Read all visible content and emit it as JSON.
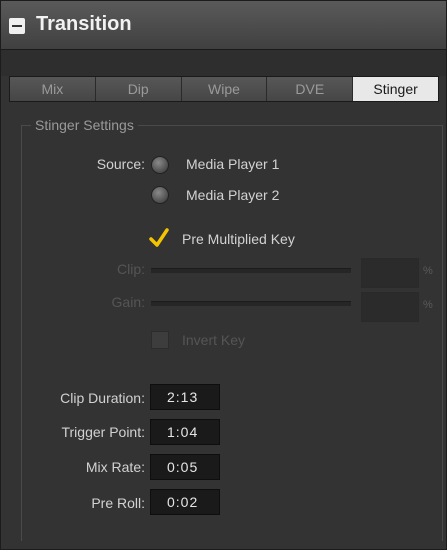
{
  "panel": {
    "title": "Transition"
  },
  "tabs": [
    {
      "label": "Mix",
      "active": false
    },
    {
      "label": "Dip",
      "active": false
    },
    {
      "label": "Wipe",
      "active": false
    },
    {
      "label": "DVE",
      "active": false
    },
    {
      "label": "Stinger",
      "active": true
    }
  ],
  "stinger": {
    "group_label": "Stinger Settings",
    "source_label": "Source:",
    "source_options": [
      "Media Player 1",
      "Media Player 2"
    ],
    "pre_multiplied_key": {
      "label": "Pre Multiplied Key",
      "checked": true
    },
    "clip": {
      "label": "Clip:",
      "unit": "%"
    },
    "gain": {
      "label": "Gain:",
      "unit": "%"
    },
    "invert_key": {
      "label": "Invert Key",
      "checked": false
    },
    "durations": [
      {
        "label": "Clip Duration:",
        "value": "2:13"
      },
      {
        "label": "Trigger Point:",
        "value": "1:04"
      },
      {
        "label": "Mix Rate:",
        "value": "0:05"
      },
      {
        "label": "Pre Roll:",
        "value": "0:02"
      }
    ]
  },
  "colors": {
    "check_accent": "#f5c400",
    "active_tab": "#e8e8e8",
    "field_bg": "#1a1a1a"
  }
}
